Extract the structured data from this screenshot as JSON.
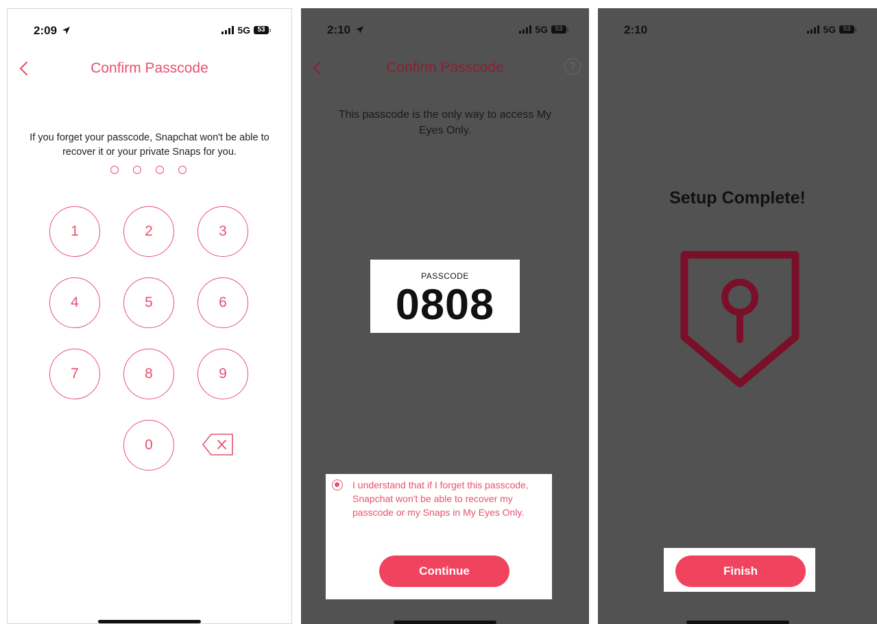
{
  "colors": {
    "accent": "#e8506f",
    "button": "#f0435e",
    "overlay": "#525252",
    "shield": "#7a0f2a"
  },
  "screen1": {
    "status": {
      "time": "2:09",
      "network": "5G",
      "battery": "53",
      "location_icon": "location-arrow-icon"
    },
    "title": "Confirm Passcode",
    "warning": "If you forget your passcode, Snapchat won't be able to recover it or your private Snaps for you.",
    "keys": [
      "1",
      "2",
      "3",
      "4",
      "5",
      "6",
      "7",
      "8",
      "9",
      "0"
    ],
    "delete_icon": "backspace-icon"
  },
  "screen2": {
    "status": {
      "time": "2:10",
      "network": "5G",
      "battery": "53"
    },
    "title": "Confirm Passcode",
    "help": "?",
    "info": "This passcode is the only way to access My Eyes Only.",
    "passcode_label": "PASSCODE",
    "passcode": "0808",
    "acknowledge": "I understand that if I forget this passcode, Snapchat won't be able to recover my passcode or my Snaps in My Eyes Only.",
    "continue": "Continue"
  },
  "screen3": {
    "status": {
      "time": "2:10",
      "network": "5G",
      "battery": "53"
    },
    "heading": "Setup Complete!",
    "finish": "Finish"
  }
}
